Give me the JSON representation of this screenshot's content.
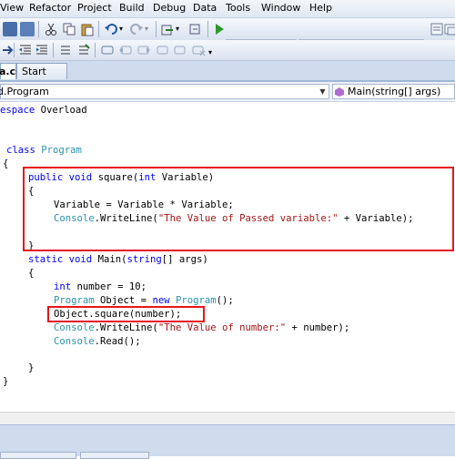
{
  "menu": {
    "items": [
      "View",
      "Refactor",
      "Project",
      "Build",
      "Debug",
      "Data",
      "Tools",
      "Window",
      "Help"
    ]
  },
  "tabs": {
    "active": "a.cs",
    "inactive": "Start Page"
  },
  "navbar": {
    "type_selector": "d.Program",
    "member_selector": "Main(string[] args)"
  },
  "code": {
    "namespace_kw": "espace",
    "namespace_name": " Overload",
    "class_kw": "class",
    "class_name": "Program",
    "brace_open": "{",
    "brace_close": "}",
    "square_sig_public": "public",
    "square_sig_void": "void",
    "square_sig_name": " square(",
    "square_sig_int": "int",
    "square_sig_param": " Variable)",
    "assign_line": "Variable = Variable * Variable;",
    "console": "Console",
    "writeline_open": ".WriteLine(",
    "writeline1_str": "\"The Value of Passed variable:\"",
    "writeline1_tail": " + Variable);",
    "main_static": "static",
    "main_void": "void",
    "main_name": " Main(",
    "main_string": "string",
    "main_args": "[] args)",
    "int_kw": "int",
    "number_decl": " number = 10;",
    "program_type": "Program",
    "object_decl": " Object = ",
    "new_kw": "new",
    "program_ctor": "();",
    "call_square": "Object.square(number);",
    "writeline2_str": "\"The Value of number:\"",
    "writeline2_tail": " + number);",
    "read_tail": ".Read();"
  },
  "colors": {
    "keyword": "#0000ff",
    "type": "#2b91af",
    "string": "#a31515",
    "highlight_box": "#e8141b"
  }
}
